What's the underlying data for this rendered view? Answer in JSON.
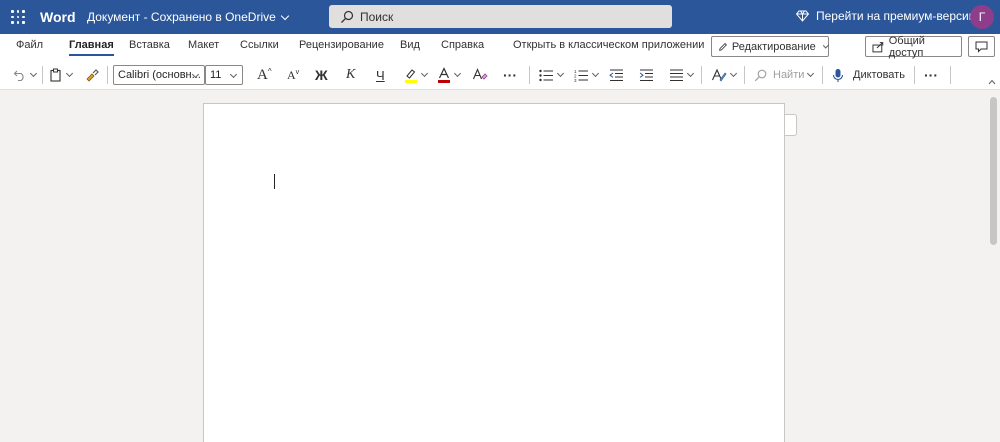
{
  "titlebar": {
    "app_name": "Word",
    "doc_title": "Документ - Сохранено в OneDrive",
    "search_placeholder": "Поиск",
    "premium_label": "Перейти на премиум-версию",
    "avatar_initial": "Г",
    "bg_color": "#2b579a"
  },
  "tabs": [
    {
      "label": "Файл"
    },
    {
      "label": "Главная",
      "active": true
    },
    {
      "label": "Вставка"
    },
    {
      "label": "Макет"
    },
    {
      "label": "Ссылки"
    },
    {
      "label": "Рецензирование"
    },
    {
      "label": "Вид"
    },
    {
      "label": "Справка"
    },
    {
      "label": "Открыть в классическом приложении"
    }
  ],
  "ribbon_actions": {
    "editing_label": "Редактирование",
    "share_label": "Общий доступ"
  },
  "toolbar": {
    "font_name": "Calibri (основн...",
    "font_size": "11",
    "grow_font": "A",
    "shrink_font": "A",
    "bold": "Ж",
    "italic": "К",
    "underline": "Ч",
    "highlight_color": "#ffff00",
    "font_color": "#c00000",
    "find_label": "Найти",
    "dictate_label": "Диктовать",
    "more": "···"
  }
}
